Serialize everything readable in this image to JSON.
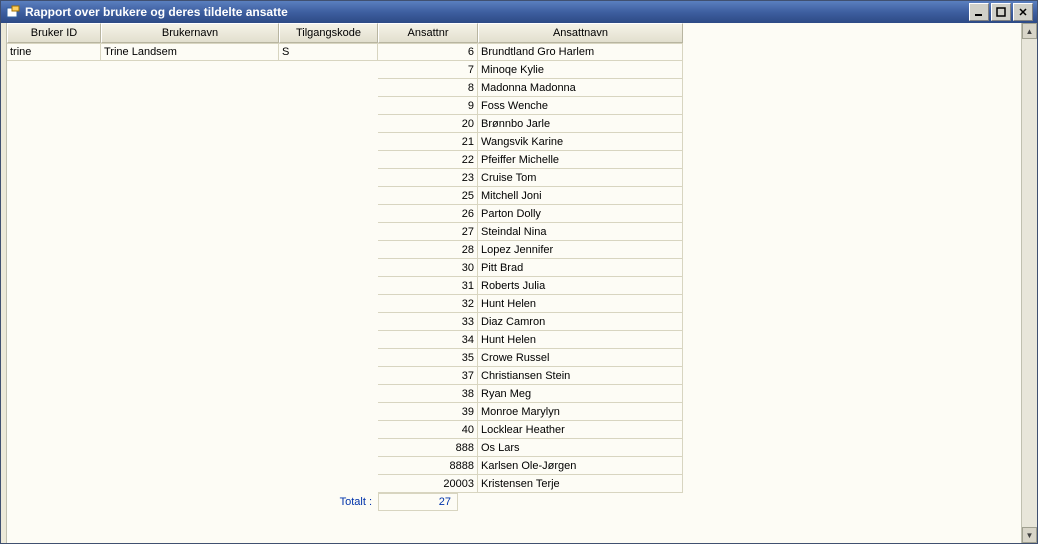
{
  "window": {
    "title": "Rapport over brukere og deres tildelte ansatte"
  },
  "columns": {
    "userid": "Bruker ID",
    "username": "Brukernavn",
    "access": "Tilgangskode",
    "empno": "Ansattnr",
    "empname": "Ansattnavn"
  },
  "user": {
    "id": "trine",
    "name": "Trine Landsem",
    "access": "S"
  },
  "employees": [
    {
      "no": "6",
      "name": "Brundtland Gro Harlem"
    },
    {
      "no": "7",
      "name": "Minoqe Kylie"
    },
    {
      "no": "8",
      "name": "Madonna Madonna"
    },
    {
      "no": "9",
      "name": "Foss Wenche"
    },
    {
      "no": "20",
      "name": "Brønnbo Jarle"
    },
    {
      "no": "21",
      "name": "Wangsvik Karine"
    },
    {
      "no": "22",
      "name": "Pfeiffer Michelle"
    },
    {
      "no": "23",
      "name": "Cruise Tom"
    },
    {
      "no": "25",
      "name": "Mitchell Joni"
    },
    {
      "no": "26",
      "name": "Parton Dolly"
    },
    {
      "no": "27",
      "name": "Steindal Nina"
    },
    {
      "no": "28",
      "name": "Lopez Jennifer"
    },
    {
      "no": "30",
      "name": "Pitt Brad"
    },
    {
      "no": "31",
      "name": "Roberts Julia"
    },
    {
      "no": "32",
      "name": "Hunt Helen"
    },
    {
      "no": "33",
      "name": "Diaz Camron"
    },
    {
      "no": "34",
      "name": "Hunt Helen"
    },
    {
      "no": "35",
      "name": "Crowe Russel"
    },
    {
      "no": "37",
      "name": "Christiansen Stein"
    },
    {
      "no": "38",
      "name": "Ryan Meg"
    },
    {
      "no": "39",
      "name": "Monroe Marylyn"
    },
    {
      "no": "40",
      "name": "Locklear Heather"
    },
    {
      "no": "888",
      "name": "Os Lars"
    },
    {
      "no": "8888",
      "name": "Karlsen Ole-Jørgen"
    },
    {
      "no": "20003",
      "name": "Kristensen Terje"
    }
  ],
  "footer": {
    "label": "Totalt :",
    "value": "27"
  }
}
